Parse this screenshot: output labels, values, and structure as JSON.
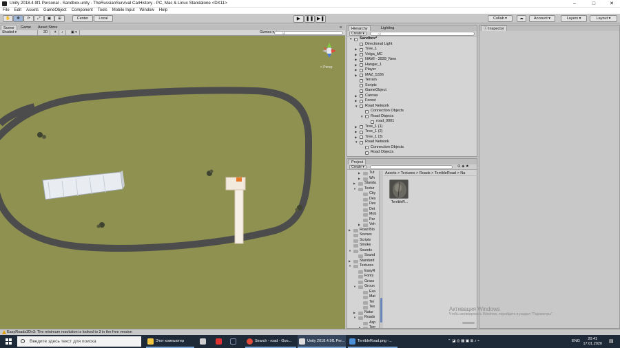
{
  "window": {
    "title": "Unity 2018.4.9f1 Personal - Sandbox.unity - TheRussianSurvival CarHistory - PC, Mac & Linux Standalone <DX11>",
    "controls": [
      "–",
      "□",
      "✕"
    ]
  },
  "menu": [
    "File",
    "Edit",
    "Assets",
    "GameObject",
    "Component",
    "Tools",
    "Mobile Input",
    "Window",
    "Help"
  ],
  "toolbar": {
    "pivot": "Center",
    "space": "Local",
    "collab": "Collab ▾",
    "account": "Account ▾",
    "layers": "Layers",
    "layout": "Layout"
  },
  "scene": {
    "tabs": [
      "Scene",
      "Game",
      "Asset Store"
    ],
    "shading": "Shaded",
    "mode_2d": "2D",
    "gizmos": "Gizmos",
    "search_placeholder": "All",
    "gizmo_label": "< Persp"
  },
  "hierarchy": {
    "tabs": [
      "Hierarchy",
      "Lighting"
    ],
    "create": "Create",
    "search_placeholder": "All",
    "items": [
      {
        "label": "Sandbox*",
        "depth": 0,
        "arrow": "▼",
        "root": true
      },
      {
        "label": "Directional Light",
        "depth": 1,
        "arrow": ""
      },
      {
        "label": "Tree_1",
        "depth": 1,
        "arrow": "▶"
      },
      {
        "label": "Volga_MC",
        "depth": 1,
        "arrow": "▶"
      },
      {
        "label": "NAMI - 3939_New",
        "depth": 1,
        "arrow": "▶"
      },
      {
        "label": "Hangar_1",
        "depth": 1,
        "arrow": "▶"
      },
      {
        "label": "Player",
        "depth": 1,
        "arrow": "▶"
      },
      {
        "label": "MAZ_5336",
        "depth": 1,
        "arrow": "▶"
      },
      {
        "label": "Terrain",
        "depth": 1,
        "arrow": ""
      },
      {
        "label": "Scripts",
        "depth": 1,
        "arrow": ""
      },
      {
        "label": "GameObject",
        "depth": 1,
        "arrow": ""
      },
      {
        "label": "Canvas",
        "depth": 1,
        "arrow": "▶"
      },
      {
        "label": "Forest",
        "depth": 1,
        "arrow": "▶"
      },
      {
        "label": "Road Network",
        "depth": 1,
        "arrow": "▼"
      },
      {
        "label": "Connection Objects",
        "depth": 2,
        "arrow": ""
      },
      {
        "label": "Road Objects",
        "depth": 2,
        "arrow": "▼"
      },
      {
        "label": "road_0001",
        "depth": 3,
        "arrow": ""
      },
      {
        "label": "Tree_1 (1)",
        "depth": 1,
        "arrow": "▶"
      },
      {
        "label": "Tree_1 (2)",
        "depth": 1,
        "arrow": "▶"
      },
      {
        "label": "Tree_1 (3)",
        "depth": 1,
        "arrow": "▶"
      },
      {
        "label": "Road Network",
        "depth": 1,
        "arrow": "▼"
      },
      {
        "label": "Connection Objects",
        "depth": 2,
        "arrow": ""
      },
      {
        "label": "Road Objects",
        "depth": 2,
        "arrow": ""
      }
    ]
  },
  "project": {
    "tab": "Project",
    "create": "Create",
    "breadcrumb": "Assets > Textures > Roads > TerribleRoad > Na",
    "tree": [
      {
        "label": "Tut",
        "depth": 2,
        "arrow": "▶"
      },
      {
        "label": "Wh",
        "depth": 2,
        "arrow": "▶"
      },
      {
        "label": "Standa",
        "depth": 1,
        "arrow": "▶"
      },
      {
        "label": "Textur",
        "depth": 1,
        "arrow": "▼"
      },
      {
        "label": "City",
        "depth": 2,
        "arrow": ""
      },
      {
        "label": "Des",
        "depth": 2,
        "arrow": ""
      },
      {
        "label": "Dev",
        "depth": 2,
        "arrow": ""
      },
      {
        "label": "Det",
        "depth": 2,
        "arrow": ""
      },
      {
        "label": "Mob",
        "depth": 2,
        "arrow": ""
      },
      {
        "label": "Par",
        "depth": 2,
        "arrow": ""
      },
      {
        "label": "Veh",
        "depth": 2,
        "arrow": "▶"
      },
      {
        "label": "Road Blo",
        "depth": 0,
        "arrow": "▶"
      },
      {
        "label": "Scenes",
        "depth": 0,
        "arrow": ""
      },
      {
        "label": "Scripts",
        "depth": 0,
        "arrow": ""
      },
      {
        "label": "Smoke",
        "depth": 0,
        "arrow": ""
      },
      {
        "label": "Sounds",
        "depth": 0,
        "arrow": "▼"
      },
      {
        "label": "Sound",
        "depth": 1,
        "arrow": ""
      },
      {
        "label": "Standard",
        "depth": 0,
        "arrow": "▶"
      },
      {
        "label": "Textures",
        "depth": 0,
        "arrow": "▼"
      },
      {
        "label": "EasyR",
        "depth": 1,
        "arrow": ""
      },
      {
        "label": "Fonts",
        "depth": 1,
        "arrow": ""
      },
      {
        "label": "Grass",
        "depth": 1,
        "arrow": ""
      },
      {
        "label": "Groun",
        "depth": 1,
        "arrow": "▼"
      },
      {
        "label": "Exa",
        "depth": 2,
        "arrow": ""
      },
      {
        "label": "Mat",
        "depth": 2,
        "arrow": ""
      },
      {
        "label": "Ter",
        "depth": 2,
        "arrow": ""
      },
      {
        "label": "Tex",
        "depth": 2,
        "arrow": ""
      },
      {
        "label": "Natur",
        "depth": 1,
        "arrow": "▶"
      },
      {
        "label": "Roads",
        "depth": 1,
        "arrow": "▼"
      },
      {
        "label": "Asp",
        "depth": 2,
        "arrow": ""
      },
      {
        "label": "Terr",
        "depth": 2,
        "arrow": "▼"
      }
    ],
    "asset": "TerribleR..."
  },
  "inspector": {
    "tab": "Inspector"
  },
  "watermark": {
    "line1": "Активация Windows",
    "line2": "Чтобы активировать Windows, перейдите в раздел \"Параметры\"."
  },
  "status": {
    "message": "EasyRoads3Dv3: The minimum resolution is looked to 3 in the free version"
  },
  "taskbar": {
    "search_placeholder": "Введите здесь текст для поиска",
    "apps": [
      {
        "label": "Этот компьютер",
        "color": "#f2c744"
      },
      {
        "label": "Search - road - Goo...",
        "color": "#e04b3a"
      },
      {
        "label": "Unity 2018.4.9f1 Per...",
        "color": "#dddddd"
      },
      {
        "label": "TerribleRoad.png -...",
        "color": "#4d8fd6"
      }
    ],
    "lang": "ENG",
    "time": "20:41",
    "date": "17.01.2020"
  },
  "colors": {
    "terrain": "#8f9151",
    "road": "#4b4c4b",
    "selection": "#9fb8d8"
  }
}
